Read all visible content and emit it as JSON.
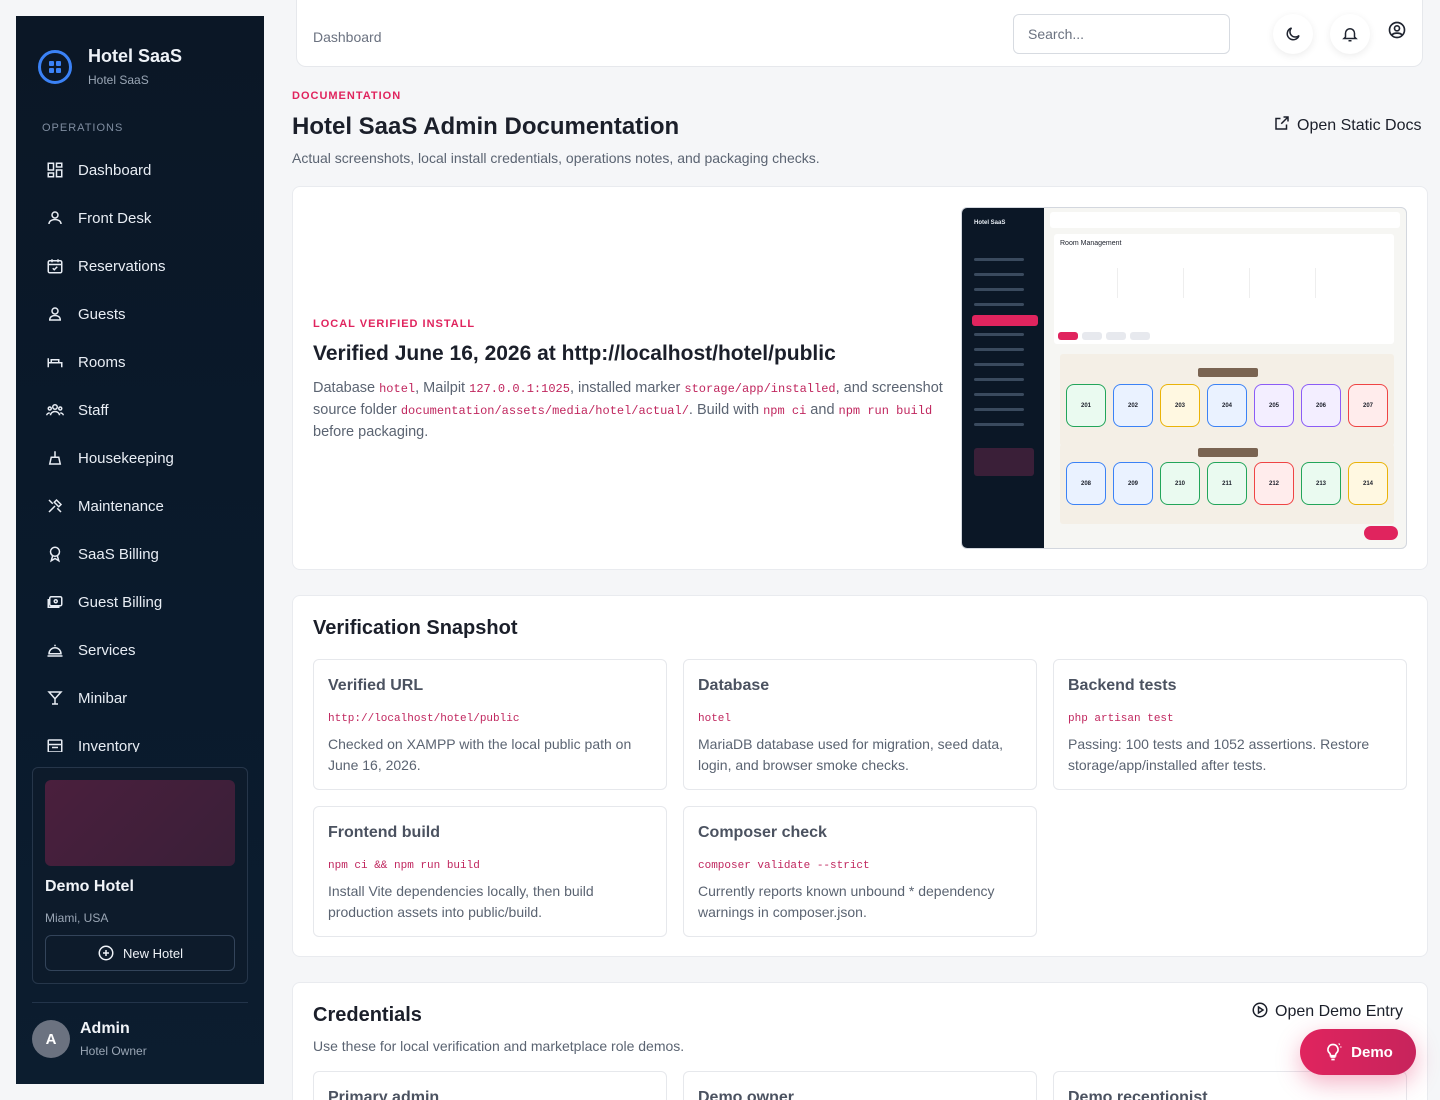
{
  "brand": {
    "title": "Hotel SaaS",
    "subtitle": "Hotel SaaS"
  },
  "sidebar": {
    "section_label": "OPERATIONS",
    "items": [
      {
        "label": "Dashboard",
        "icon": "dashboard-icon"
      },
      {
        "label": "Front Desk",
        "icon": "front-desk-icon"
      },
      {
        "label": "Reservations",
        "icon": "calendar-icon"
      },
      {
        "label": "Guests",
        "icon": "user-icon"
      },
      {
        "label": "Rooms",
        "icon": "bed-icon"
      },
      {
        "label": "Staff",
        "icon": "users-icon"
      },
      {
        "label": "Housekeeping",
        "icon": "broom-icon"
      },
      {
        "label": "Maintenance",
        "icon": "tools-icon"
      },
      {
        "label": "SaaS Billing",
        "icon": "badge-icon"
      },
      {
        "label": "Guest Billing",
        "icon": "billing-icon"
      },
      {
        "label": "Services",
        "icon": "bell-service-icon"
      },
      {
        "label": "Minibar",
        "icon": "glass-icon"
      },
      {
        "label": "Inventory",
        "icon": "inventory-icon"
      }
    ],
    "hotel": {
      "name": "Demo Hotel",
      "location": "Miami, USA",
      "new_hotel_label": "New Hotel"
    },
    "user": {
      "initial": "A",
      "name": "Admin",
      "role": "Hotel Owner"
    }
  },
  "topbar": {
    "breadcrumb": "Dashboard",
    "search_placeholder": "Search..."
  },
  "header": {
    "eyebrow": "DOCUMENTATION",
    "title": "Hotel SaaS Admin Documentation",
    "subtitle": "Actual screenshots, local install credentials, operations notes, and packaging checks.",
    "static_docs_label": "Open Static Docs"
  },
  "hero": {
    "eyebrow": "LOCAL VERIFIED INSTALL",
    "title": "Verified June 16, 2026 at http://localhost/hotel/public",
    "body": {
      "t1": "Database ",
      "c1": "hotel",
      "t2": ", Mailpit ",
      "c2": "127.0.0.1:1025",
      "t3": ", installed marker ",
      "c3": "storage/app/installed",
      "t4": ", and screenshot source folder ",
      "c4": "documentation/assets/media/hotel/actual/",
      "t5": ". Build with ",
      "c5": "npm ci",
      "t6": " and ",
      "c6": "npm run build",
      "t7": " before packaging."
    },
    "screenshot": {
      "brand": "Hotel SaaS",
      "panel_title": "Room Management",
      "floor_top": [
        "201",
        "202",
        "203",
        "204",
        "205",
        "206",
        "207"
      ],
      "floor_bottom": [
        "208",
        "209",
        "210",
        "211",
        "212",
        "213",
        "214"
      ]
    }
  },
  "verification": {
    "title": "Verification Snapshot",
    "tiles": [
      {
        "title": "Verified URL",
        "code": "http://localhost/hotel/public",
        "body": "Checked on XAMPP with the local public path on June 16, 2026."
      },
      {
        "title": "Database",
        "code": "hotel",
        "body": "MariaDB database used for migration, seed data, login, and browser smoke checks."
      },
      {
        "title": "Backend tests",
        "code": "php artisan test",
        "body": "Passing: 100 tests and 1052 assertions. Restore storage/app/installed after tests."
      },
      {
        "title": "Frontend build",
        "code": "npm ci && npm run build",
        "body": "Install Vite dependencies locally, then build production assets into public/build."
      },
      {
        "title": "Composer check",
        "code": "composer validate --strict",
        "body": "Currently reports known unbound * dependency warnings in composer.json."
      }
    ]
  },
  "credentials": {
    "title": "Credentials",
    "subtitle": "Use these for local verification and marketplace role demos.",
    "demo_entry_label": "Open Demo Entry",
    "tiles": [
      {
        "title": "Primary admin"
      },
      {
        "title": "Demo owner"
      },
      {
        "title": "Demo receptionist"
      }
    ]
  },
  "demo_button": {
    "label": "Demo"
  },
  "colors": {
    "accent": "#e0245e",
    "sidebar_bg": "#0b1726",
    "brand_ring": "#3b82f6"
  }
}
